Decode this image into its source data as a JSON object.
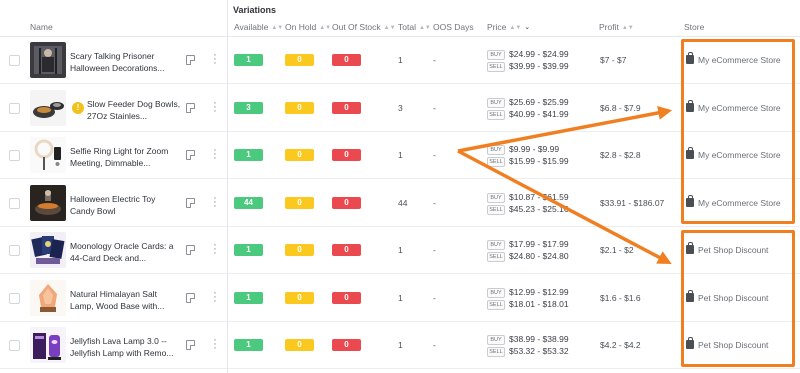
{
  "header": {
    "section_title": "Variations",
    "columns": {
      "name": "Name",
      "available": "Available",
      "on_hold": "On Hold",
      "out_of_stock": "Out Of Stock",
      "total": "Total",
      "oos_days": "OOS Days",
      "price": "Price",
      "profit": "Profit",
      "store": "Store"
    }
  },
  "price_tags": {
    "buy": "BUY",
    "sell": "SELL"
  },
  "rows": [
    {
      "name": "Scary Talking Prisoner Halloween Decorations...",
      "thumb": "prisoner-figure",
      "warning": false,
      "available": "1",
      "on_hold": "0",
      "out_of_stock": "0",
      "total": "1",
      "oos_days": "-",
      "buy": "$24.99 - $24.99",
      "sell": "$39.99 - $39.99",
      "profit": "$7 - $7",
      "store": "My eCommerce Store"
    },
    {
      "name": "Slow Feeder Dog Bowls, 27Oz Stainles...",
      "thumb": "dog-bowls",
      "warning": true,
      "available": "3",
      "on_hold": "0",
      "out_of_stock": "0",
      "total": "3",
      "oos_days": "-",
      "buy": "$25.69 - $25.99",
      "sell": "$40.99 - $41.99",
      "profit": "$6.8 - $7.9",
      "store": "My eCommerce Store"
    },
    {
      "name": "Selfie Ring Light for Zoom Meeting, Dimmable...",
      "thumb": "ring-light",
      "warning": false,
      "available": "1",
      "on_hold": "0",
      "out_of_stock": "0",
      "total": "1",
      "oos_days": "-",
      "buy": "$9.99 - $9.99",
      "sell": "$15.99 - $15.99",
      "profit": "$2.8 - $2.8",
      "store": "My eCommerce Store"
    },
    {
      "name": "Halloween Electric Toy Candy Bowl",
      "thumb": "candy-bowl",
      "warning": false,
      "available": "44",
      "on_hold": "0",
      "out_of_stock": "0",
      "total": "44",
      "oos_days": "-",
      "buy": "$10.87 - $61.59",
      "sell": "$45.23 - $25.16",
      "profit": "$33.91 - $186.07",
      "store": "My eCommerce Store"
    },
    {
      "name": "Moonology Oracle Cards: a 44-Card Deck and...",
      "thumb": "oracle-cards",
      "warning": false,
      "available": "1",
      "on_hold": "0",
      "out_of_stock": "0",
      "total": "1",
      "oos_days": "-",
      "buy": "$17.99 - $17.99",
      "sell": "$24.80 - $24.80",
      "profit": "$2.1 - $2",
      "store": "Pet Shop Discount"
    },
    {
      "name": "Natural Himalayan Salt Lamp, Wood Base with...",
      "thumb": "salt-lamp",
      "warning": false,
      "available": "1",
      "on_hold": "0",
      "out_of_stock": "0",
      "total": "1",
      "oos_days": "-",
      "buy": "$12.99 - $12.99",
      "sell": "$18.01 - $18.01",
      "profit": "$1.6 - $1.6",
      "store": "Pet Shop Discount"
    },
    {
      "name": "Jellyfish Lava Lamp 3.0 -- Jellyfish Lamp with Remo...",
      "thumb": "jellyfish-lamp",
      "warning": false,
      "available": "1",
      "on_hold": "0",
      "out_of_stock": "0",
      "total": "1",
      "oos_days": "-",
      "buy": "$38.99 - $38.99",
      "sell": "$53.32 - $53.32",
      "profit": "$4.2 - $4.2",
      "store": "Pet Shop Discount"
    }
  ],
  "colors": {
    "available": "#4bc97f",
    "on_hold": "#fbc81f",
    "out_of_stock": "#ea4a4f",
    "annotation": "#f07f22",
    "warning": "#f1c21b"
  }
}
